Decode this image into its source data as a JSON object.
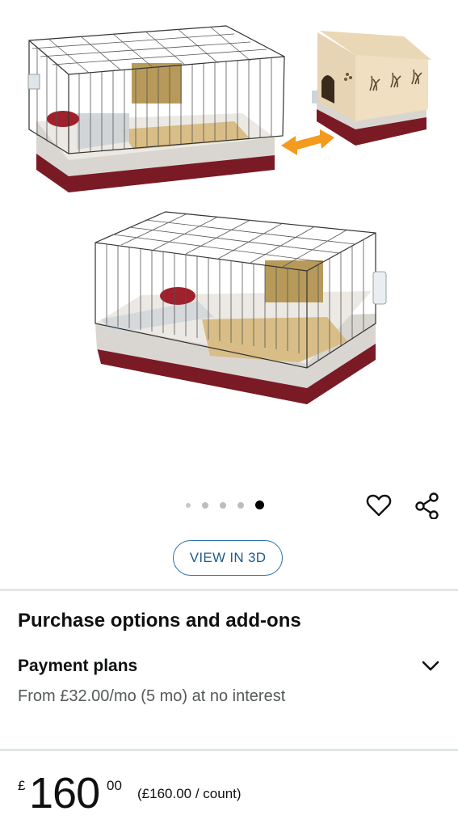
{
  "product_images": {
    "dot_count": 5,
    "active_index": 4,
    "image_alt": "rabbit-cage-with-wooden-house"
  },
  "actions": {
    "wishlist_icon": "heart-outline-icon",
    "share_icon": "share-icon"
  },
  "view_3d": {
    "label": "VIEW IN 3D"
  },
  "purchase_options": {
    "title": "Purchase options and add-ons",
    "payment_plans": {
      "title": "Payment plans",
      "description": "From £32.00/mo (5 mo) at no interest",
      "expand_icon": "chevron-down-icon"
    }
  },
  "price": {
    "currency": "£",
    "whole": "160",
    "fraction": "00",
    "unit_price": "(£160.00 / count)"
  },
  "colors": {
    "accent_link": "#1f5c8e",
    "divider": "#e3e6e6",
    "cage_base": "#7a1a25",
    "cage_tray": "#d9d6d1"
  }
}
